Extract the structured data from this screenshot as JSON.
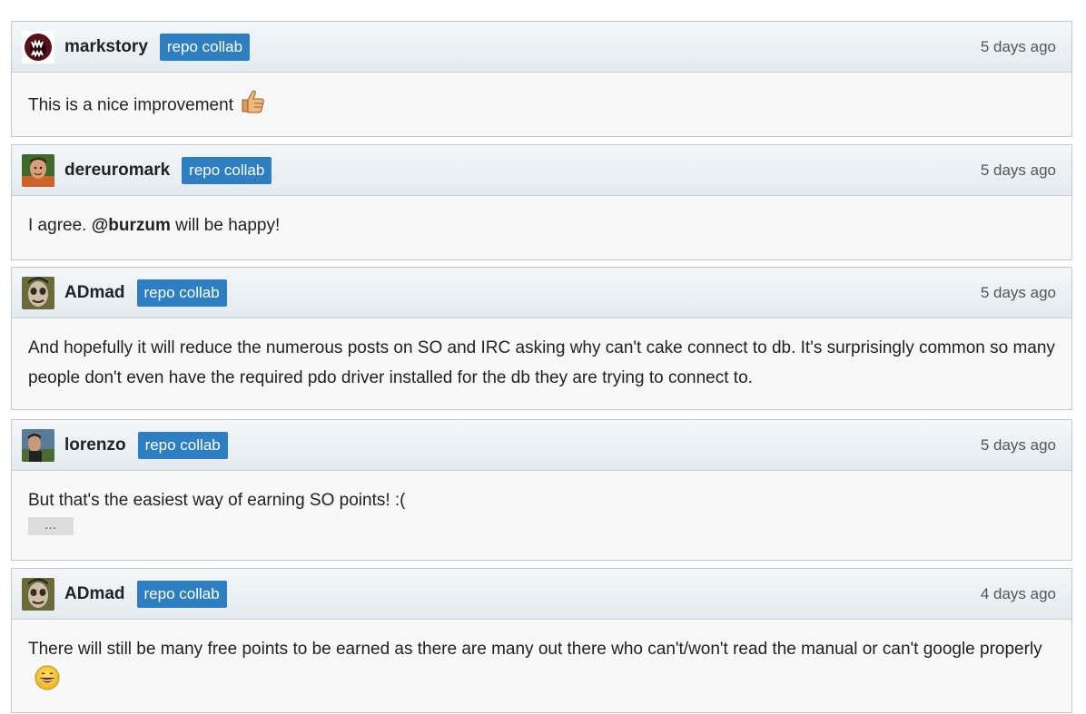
{
  "comments": [
    {
      "author": "markstory",
      "badge": "repo collab",
      "timestamp": "5 days ago",
      "text": "This is a nice improvement",
      "emoji": "thumbs-up"
    },
    {
      "author": "dereuromark",
      "badge": "repo collab",
      "timestamp": "5 days ago",
      "text_before": "I agree. ",
      "mention": "@burzum",
      "text_after": " will be happy!"
    },
    {
      "author": "ADmad",
      "badge": "repo collab",
      "timestamp": "5 days ago",
      "text": "And hopefully it will reduce the numerous posts on SO and IRC asking why can't cake connect to db. It's surprisingly common so many people don't even have the required pdo driver installed for the db they are trying to connect to."
    },
    {
      "author": "lorenzo",
      "badge": "repo collab",
      "timestamp": "5 days ago",
      "text": "But that's the easiest way of earning SO points! :(",
      "expand_label": "…"
    },
    {
      "author": "ADmad",
      "badge": "repo collab",
      "timestamp": "4 days ago",
      "text": "There will still be many free points to be earned as there are many out there who can't/won't read the manual or can't google properly",
      "emoji": "smile"
    }
  ],
  "colors": {
    "badge": "#2d7fc1",
    "header_gradient_top": "#f4f7f9",
    "header_gradient_bottom": "#e3eaef",
    "body_bg": "#f8f8f8"
  }
}
